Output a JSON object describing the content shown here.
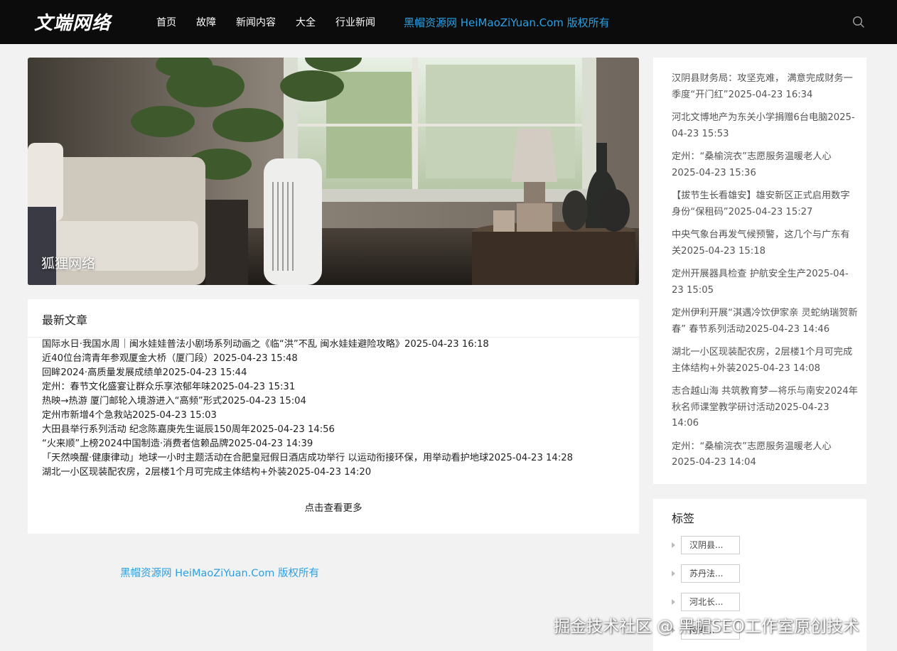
{
  "header": {
    "logo": "文端网络",
    "nav": [
      "首页",
      "故障",
      "新闻内容",
      "大全",
      "行业新闻"
    ],
    "copyright_link": "黑帽资源网 HeiMaoZiYuan.Com 版权所有"
  },
  "banner": {
    "caption": "狐狸网络"
  },
  "latest": {
    "title": "最新文章",
    "items": [
      "国际水日·我国水周｜闽水娃娃普法小剧场系列动画之《临“洪”不乱 闽水娃娃避险攻略》2025-04-23 16:18",
      "近40位台湾青年参观厦金大桥（厦门段）2025-04-23 15:48",
      "回眸2024·高质量发展成绩单2025-04-23 15:44",
      "定州：春节文化盛宴让群众乐享浓郁年味2025-04-23 15:31",
      "热映→热游 厦门邮轮入境游进入“高频”形式2025-04-23 15:04",
      "定州市新增4个急救站2025-04-23 15:03",
      "大田县举行系列活动 纪念陈嘉庚先生诞辰150周年2025-04-23 14:56",
      "“火来顺”上榜2024中国制造·消费者信赖品牌2025-04-23 14:39",
      "「天然唤醒·健康律动」地球一小时主题活动在合肥皇冠假日酒店成功举行 以运动衔接环保，用举动看护地球2025-04-23 14:28",
      "湖北一小区现装配农房，2层楼1个月可完成主体结构+外装2025-04-23 14:20"
    ],
    "more": "点击查看更多"
  },
  "footer": {
    "copyright": "黑帽资源网 HeiMaoZiYuan.Com 版权所有"
  },
  "sidebar": {
    "news": [
      "汉阴县财务局：攻坚克难， 满意完成财务一季度“开门红”2025-04-23 16:34",
      "河北文博地产为东关小学捐赠6台电脑2025-04-23 15:53",
      "定州：“桑榆浣衣”志愿服务温暖老人心2025-04-23 15:36",
      "【拔节生长看雄安】雄安新区正式启用数字身份“保租码”2025-04-23 15:27",
      "中央气象台再发气候预警，这几个与广东有关2025-04-23 15:18",
      "定州开展器具检查 护航安全生产2025-04-23 15:05",
      "定州伊利开展“淇遇冷饮伊家亲 灵蛇纳瑞贺新春” 春节系列活动2025-04-23 14:46",
      "湖北一小区现装配农房，2层楼1个月可完成主体结构+外装2025-04-23 14:08",
      "志合越山海 共筑教育梦—将乐与南安2024年秋名师课堂教学研讨活动2025-04-23 14:06",
      "定州：“桑榆浣衣”志愿服务温暖老人心2025-04-23 14:04"
    ],
    "tags_title": "标签",
    "tags": [
      "汉阴县...",
      "苏丹法...",
      "河北长...",
      "阿库..."
    ]
  },
  "watermark": "掘金技术社区 @ 黑帽SEO工作室原创技术",
  "colors": {
    "header_bg": "#0c0c0c",
    "accent_link": "#2d9fe0",
    "page_bg": "#f2f2f2"
  }
}
